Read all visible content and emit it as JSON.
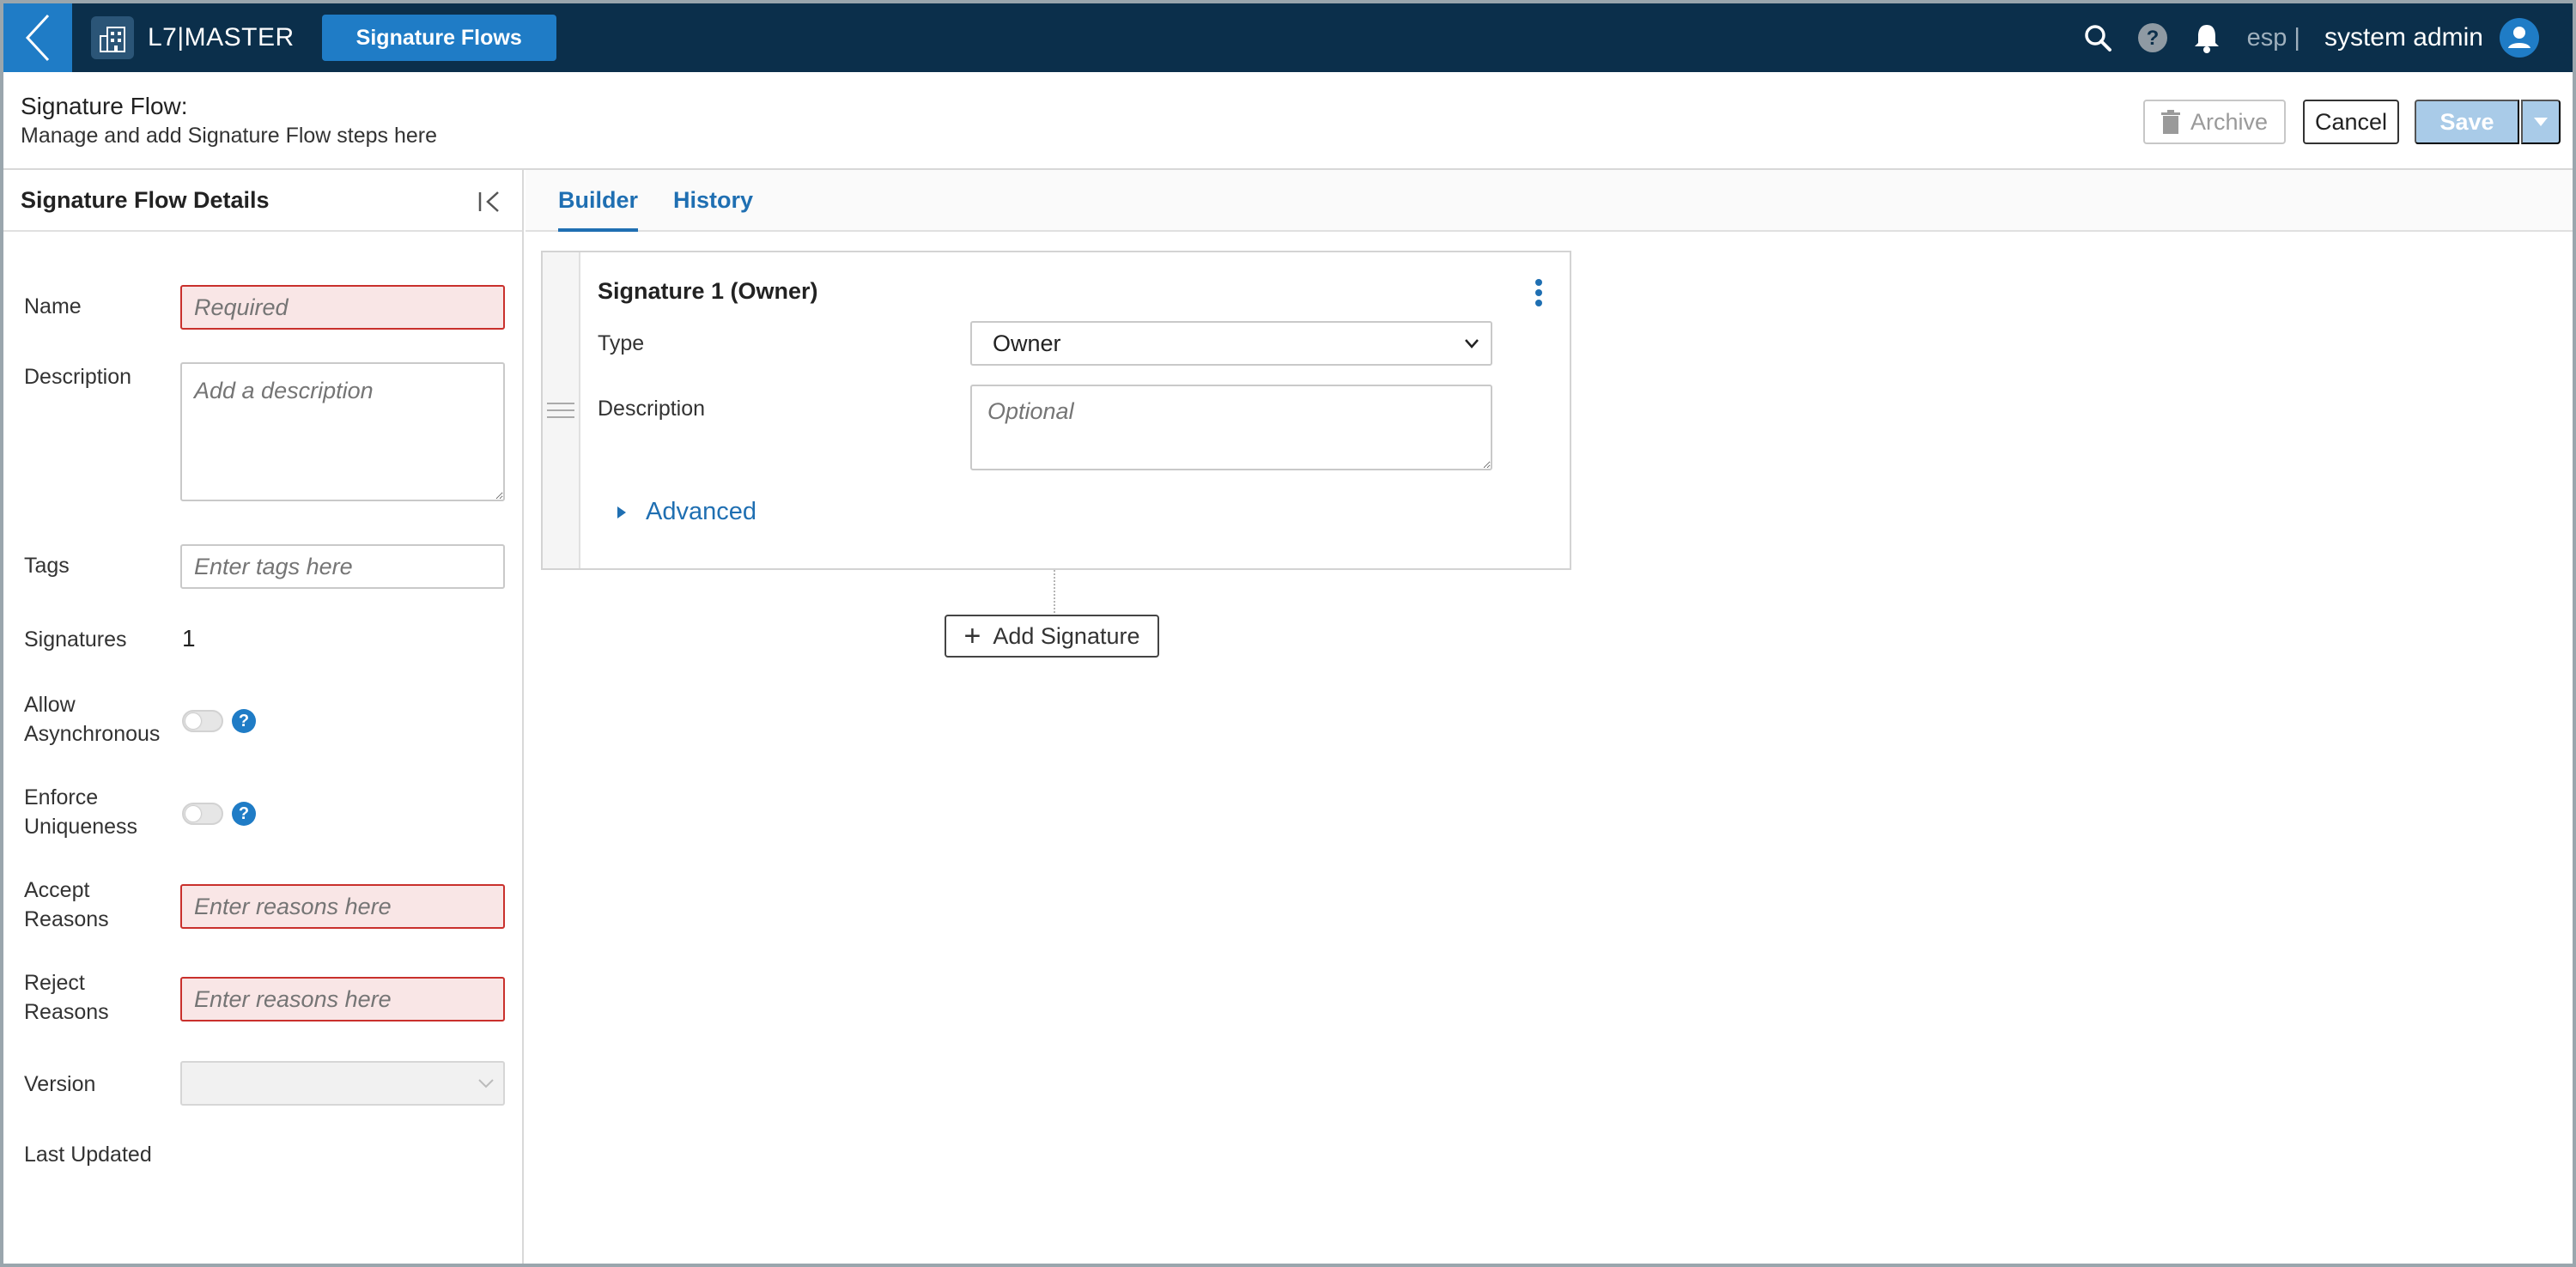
{
  "nav": {
    "app_name": "L7|MASTER",
    "active_tab": "Signature Flows",
    "language": "esp |",
    "user_name": "system admin"
  },
  "header": {
    "title": "Signature Flow:",
    "subtitle": "Manage and add Signature Flow steps here",
    "archive_label": "Archive",
    "cancel_label": "Cancel",
    "save_label": "Save"
  },
  "details": {
    "title": "Signature Flow Details",
    "name_label": "Name",
    "name_placeholder": "Required",
    "description_label": "Description",
    "description_placeholder": "Add a description",
    "tags_label": "Tags",
    "tags_placeholder": "Enter tags here",
    "signatures_label": "Signatures",
    "signatures_value": "1",
    "allow_async_label_1": "Allow",
    "allow_async_label_2": "Asynchronous",
    "enforce_label_1": "Enforce",
    "enforce_label_2": "Uniqueness",
    "accept_label_1": "Accept",
    "accept_label_2": "Reasons",
    "accept_placeholder": "Enter reasons here",
    "reject_label_1": "Reject",
    "reject_label_2": "Reasons",
    "reject_placeholder": "Enter reasons here",
    "version_label": "Version",
    "last_updated_label": "Last Updated",
    "help_glyph": "?"
  },
  "tabs": {
    "builder": "Builder",
    "history": "History"
  },
  "signature_card": {
    "title": "Signature 1 (Owner)",
    "type_label": "Type",
    "type_value": "Owner",
    "description_label": "Description",
    "description_placeholder": "Optional",
    "advanced_label": "Advanced"
  },
  "add_signature_label": "Add Signature",
  "colors": {
    "nav_bg": "#0b2f4b",
    "accent": "#1f7cc6",
    "link": "#1f6fb2",
    "error_border": "#c9302c",
    "error_bg": "#f9e6e6",
    "save_disabled": "#a9cbe8"
  }
}
